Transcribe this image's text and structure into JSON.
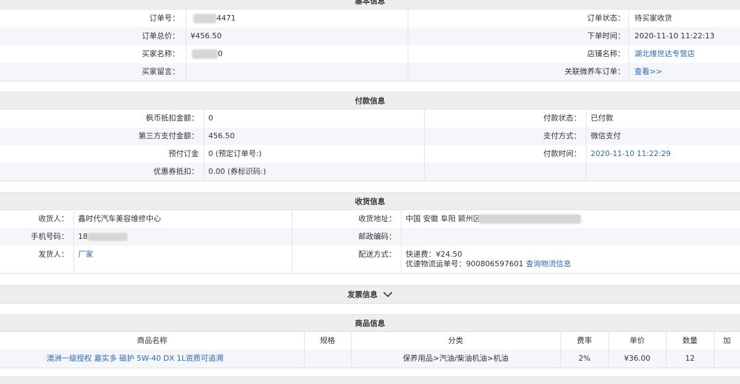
{
  "basic": {
    "title": "基本信息",
    "order_no_label": "订单号：",
    "order_no_value": "4471",
    "order_total_label": "订单总价：",
    "order_total_value": "¥456.50",
    "buyer_name_label": "买家名称：",
    "buyer_name_value": "0",
    "buyer_msg_label": "买家留言：",
    "status_label": "订单状态：",
    "status_value": "待买家收货",
    "order_time_label": "下单时间：",
    "order_time_value": "2020-11-10 11:22:13",
    "shop_label": "店铺名称：",
    "shop_value": "湖北维世达专营店",
    "linked_label": "关联微养车订单：",
    "linked_value": "查看>>"
  },
  "payment": {
    "title": "付款信息",
    "coin_label": "枫币抵扣金额：",
    "coin_value": "0",
    "third_label": "第三方支付金额：",
    "third_value": "456.50",
    "prepay_label": "预付订金",
    "prepay_value": "0 (预定订单号:)",
    "coupon_label": "优惠券抵扣：",
    "coupon_value": "0.00 (券标识码:)",
    "status_label": "付款状态：",
    "status_value": "已付款",
    "method_label": "支付方式：",
    "method_value": "微信支付",
    "time_label": "付款时间：",
    "time_value": "2020-11-10 11:22:29"
  },
  "shipping": {
    "title": "收货信息",
    "receiver_label": "收货人：",
    "receiver_value": "鑫时代汽车美容维修中心",
    "phone_label": "手机号码：",
    "phone_value": "18",
    "sender_label": "发货人：",
    "sender_value": "厂家",
    "address_label": "收货地址：",
    "address_value": "中国 安徽 阜阳 颍州区",
    "postcode_label": "邮政编码：",
    "method_label": "配送方式：",
    "fee_value": "快递费：¥24.50",
    "tracking_value": "优速物流运单号：900806597601",
    "tracking_link": "查询物流信息"
  },
  "invoice": {
    "title": "发票信息"
  },
  "goods": {
    "title": "商品信息",
    "headers": {
      "name": "商品名称",
      "spec": "规格",
      "category": "分类",
      "rate": "费率",
      "price": "单价",
      "qty": "数量",
      "more": "加"
    },
    "rows": [
      {
        "name": "澳洲一级授权 嘉实多 磁护 5W-40 DX 1L资质可追溯",
        "spec": "",
        "category": "保养用品>汽油/柴油机油>机油",
        "rate": "2%",
        "price": "¥36.00",
        "qty": "12"
      }
    ]
  }
}
